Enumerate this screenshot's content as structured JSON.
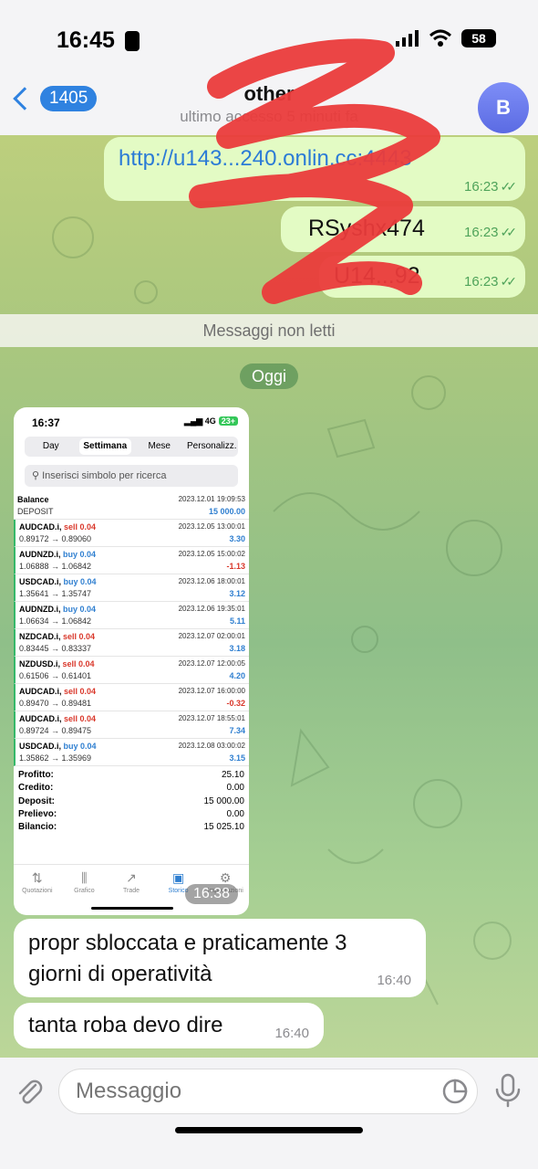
{
  "status_bar": {
    "time": "16:45",
    "battery": "58"
  },
  "header": {
    "back_count": "1405",
    "name": "other",
    "status": "ultimo accesso 5 minuti fa",
    "avatar_initial": "B"
  },
  "messages_out": [
    {
      "text": "http://u143...240.onlin.cc:4443",
      "time": "16:23"
    },
    {
      "text": "RSyshx474",
      "time": "16:23"
    },
    {
      "text": "U14...92",
      "time": "16:23"
    }
  ],
  "unread_label": "Messaggi non letti",
  "date_label": "Oggi",
  "image_message": {
    "time": "16:38",
    "screenshot": {
      "time": "16:37",
      "network": "4G",
      "battery": "23+",
      "tabs": [
        "Day",
        "Settimana",
        "Mese",
        "Personalizz."
      ],
      "search_placeholder": "Inserisci simbolo per ricerca",
      "balance": {
        "label": "Balance",
        "date": "2023.12.01 19:09:53",
        "sub": "DEPOSIT",
        "amount": "15 000.00"
      },
      "trades": [
        {
          "symbol": "AUDCAD.i,",
          "side": "sell 0.04",
          "date": "2023.12.05 13:00:01",
          "prices": "0.89172 → 0.89060",
          "pl": "3.30"
        },
        {
          "symbol": "AUDNZD.i,",
          "side": "buy 0.04",
          "date": "2023.12.05 15:00:02",
          "prices": "1.06888 → 1.06842",
          "pl": "-1.13"
        },
        {
          "symbol": "USDCAD.i,",
          "side": "buy 0.04",
          "date": "2023.12.06 18:00:01",
          "prices": "1.35641 → 1.35747",
          "pl": "3.12"
        },
        {
          "symbol": "AUDNZD.i,",
          "side": "buy 0.04",
          "date": "2023.12.06 19:35:01",
          "prices": "1.06634 → 1.06842",
          "pl": "5.11"
        },
        {
          "symbol": "NZDCAD.i,",
          "side": "sell 0.04",
          "date": "2023.12.07 02:00:01",
          "prices": "0.83445 → 0.83337",
          "pl": "3.18"
        },
        {
          "symbol": "NZDUSD.i,",
          "side": "sell 0.04",
          "date": "2023.12.07 12:00:05",
          "prices": "0.61506 → 0.61401",
          "pl": "4.20"
        },
        {
          "symbol": "AUDCAD.i,",
          "side": "sell 0.04",
          "date": "2023.12.07 16:00:00",
          "prices": "0.89470 → 0.89481",
          "pl": "-0.32"
        },
        {
          "symbol": "AUDCAD.i,",
          "side": "sell 0.04",
          "date": "2023.12.07 18:55:01",
          "prices": "0.89724 → 0.89475",
          "pl": "7.34"
        },
        {
          "symbol": "USDCAD.i,",
          "side": "buy 0.04",
          "date": "2023.12.08 03:00:02",
          "prices": "1.35862 → 1.35969",
          "pl": "3.15"
        }
      ],
      "summary": [
        {
          "label": "Profitto:",
          "value": "25.10"
        },
        {
          "label": "Credito:",
          "value": "0.00"
        },
        {
          "label": "Deposit:",
          "value": "15 000.00"
        },
        {
          "label": "Prelievo:",
          "value": "0.00"
        },
        {
          "label": "Bilancio:",
          "value": "15 025.10"
        }
      ],
      "bottom_tabs": [
        "Quotazioni",
        "Grafico",
        "Trade",
        "Storico",
        "Impostazioni"
      ]
    }
  },
  "messages_in": [
    {
      "line1": "propr sbloccata e praticamente 3",
      "line2": "giorni di operatività",
      "time": "16:40"
    },
    {
      "text": "tanta roba devo dire",
      "time": "16:40"
    }
  ],
  "composer": {
    "placeholder": "Messaggio"
  }
}
